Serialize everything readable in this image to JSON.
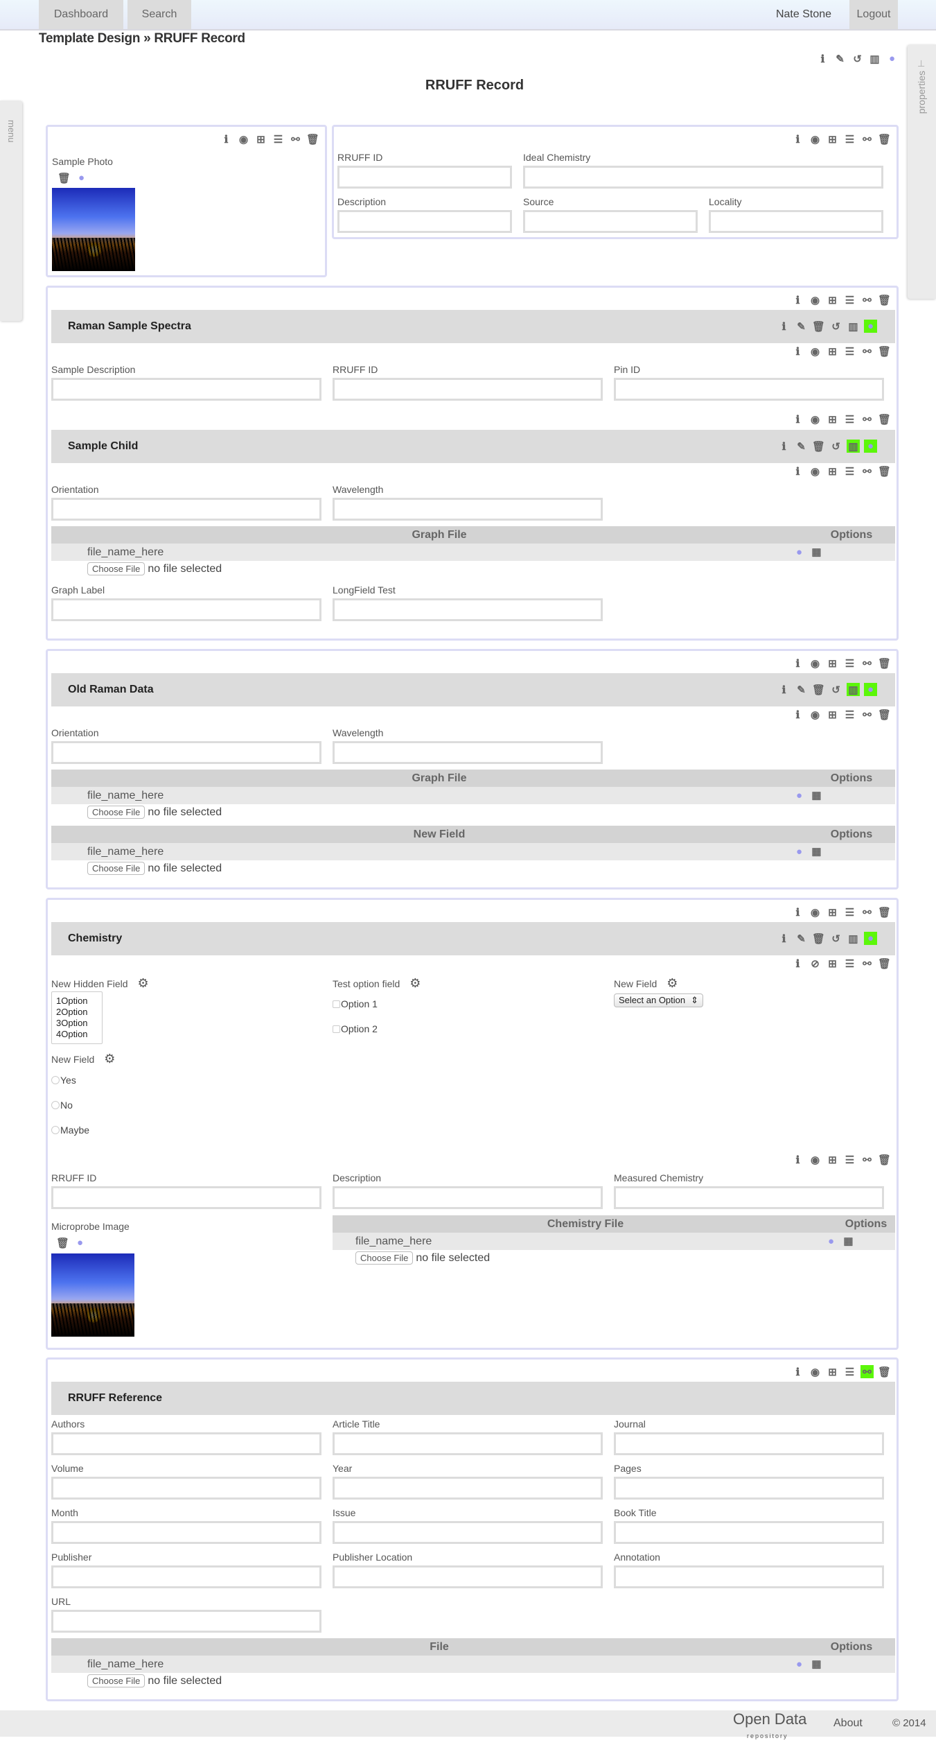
{
  "nav": {
    "dashboard": "Dashboard",
    "search": "Search",
    "user": "Nate Stone",
    "logout": "Logout"
  },
  "breadcrumb": "Template Design » RRUFF Record",
  "page_title": "RRUFF Record",
  "side": {
    "menu": "menu",
    "properties": "properties"
  },
  "colors": {
    "box_border": "#dcdcf5",
    "section_bar": "#dcdcdc",
    "active_green": "#5cf70a",
    "globe": "#9999ee"
  },
  "top_box_left": {
    "field_label": "Sample Photo"
  },
  "top_box_right": {
    "fields": [
      "RRUFF ID",
      "Ideal Chemistry",
      "Description",
      "Source",
      "Locality"
    ]
  },
  "raman": {
    "title": "Raman Sample Spectra",
    "fields": [
      "Sample Description",
      "RRUFF ID",
      "Pin ID"
    ],
    "child_title": "Sample Child",
    "child_fields": [
      "Orientation",
      "Wavelength"
    ],
    "file_header": "Graph File",
    "options_header": "Options",
    "file_name": "file_name_here",
    "choose": "Choose File",
    "no_file": "no file selected",
    "child_fields2": [
      "Graph Label",
      "LongField Test"
    ]
  },
  "old_raman": {
    "title": "Old Raman Data",
    "fields": [
      "Orientation",
      "Wavelength"
    ],
    "file1_header": "Graph File",
    "file2_header": "New Field",
    "options_header": "Options",
    "file_name": "file_name_here",
    "choose": "Choose File",
    "no_file": "no file selected"
  },
  "chemistry": {
    "title": "Chemistry",
    "hidden_field": "New Hidden Field",
    "listbox_options": [
      "1Option",
      "2Option",
      "3Option",
      "4Option"
    ],
    "test_option_field": "Test option field",
    "checkbox_options": [
      "Option 1",
      "Option 2"
    ],
    "new_field_select": "New Field",
    "select_value": "Select an Option",
    "new_field_radio": "New Field",
    "radio_options": [
      "Yes",
      "No",
      "Maybe"
    ],
    "fields": [
      "RRUFF ID",
      "Description",
      "Measured Chemistry"
    ],
    "image_label": "Microprobe Image",
    "file_header": "Chemistry File",
    "options_header": "Options",
    "file_name": "file_name_here",
    "choose": "Choose File",
    "no_file": "no file selected"
  },
  "reference": {
    "title": "RRUFF Reference",
    "fields": [
      "Authors",
      "Article Title",
      "Journal",
      "Volume",
      "Year",
      "Pages",
      "Month",
      "Issue",
      "Book Title",
      "Publisher",
      "Publisher Location",
      "Annotation",
      "URL"
    ],
    "file_header": "File",
    "options_header": "Options",
    "file_name": "file_name_here",
    "choose": "Choose File",
    "no_file": "no file selected"
  },
  "footer": {
    "logo": "Open Data",
    "logo_sub": "repository",
    "about": "About",
    "copyright": "© 2014"
  }
}
